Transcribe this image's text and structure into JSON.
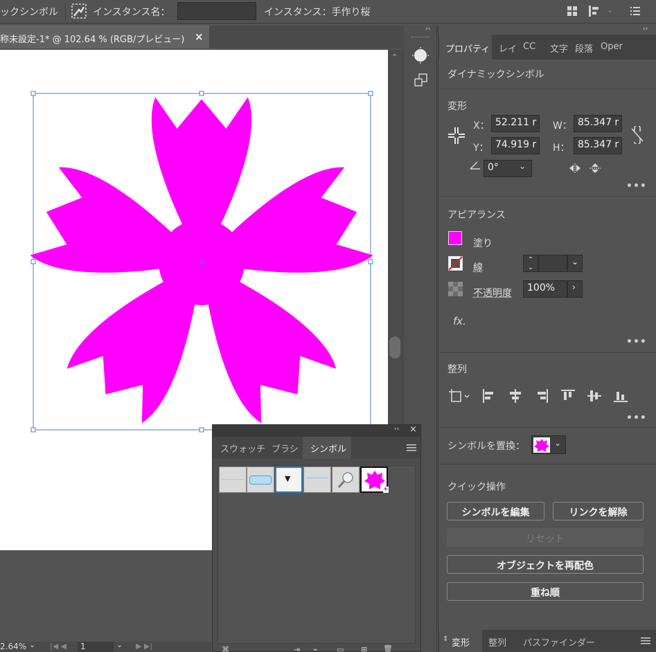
{
  "control_bar": {
    "symbol_type": "ックシンボル",
    "instance_name_label": "インスタンス名：",
    "instance_name_value": "",
    "instance_label": "インスタンス：手作り桜"
  },
  "document": {
    "tab_title": "称未設定-1* @ 102.64 % (RGB/プレビュー)",
    "close_glyph": "×"
  },
  "properties_panel": {
    "tabs": [
      "プロパティ",
      "レイ",
      "CC",
      "文字",
      "段落",
      "Oper"
    ],
    "collapse_glyph": "‹‹",
    "object_type": "ダイナミックシンボル",
    "transform": {
      "title": "変形",
      "x_label": "X：",
      "x_value": "52.211 r",
      "y_label": "Y：",
      "y_value": "74.919 r",
      "w_label": "W：",
      "w_value": "85.347 r",
      "h_label": "H：",
      "h_value": "85.347 r",
      "angle_value": "0°"
    },
    "appearance": {
      "title": "アピアランス",
      "fill_label": "塗り",
      "fill_color": "#FF00FF",
      "stroke_label": "線",
      "opacity_label": "不透明度",
      "opacity_value": "100%",
      "fx_label": "fx."
    },
    "align": {
      "title": "整列"
    },
    "replace_symbol_label": "シンボルを置換：",
    "quick_actions": {
      "title": "クイック操作",
      "edit_symbol": "シンボルを編集",
      "break_link": "リンクを解除",
      "reset": "リセット",
      "recolor": "オブジェクトを再配色",
      "arrange": "重ね順"
    },
    "bottom_tabs": [
      "変形",
      "整列",
      "パスファインダー"
    ]
  },
  "symbols_panel": {
    "tabs": [
      "スウォッチ",
      "ブラシ",
      "シンボル"
    ],
    "collapse_glyph": "‹‹",
    "close_glyph": "×"
  },
  "status_bar": {
    "zoom": "2.64%",
    "page": "1"
  },
  "colors": {
    "sakura": "#FF00FF",
    "selection": "#4a7fc1"
  }
}
